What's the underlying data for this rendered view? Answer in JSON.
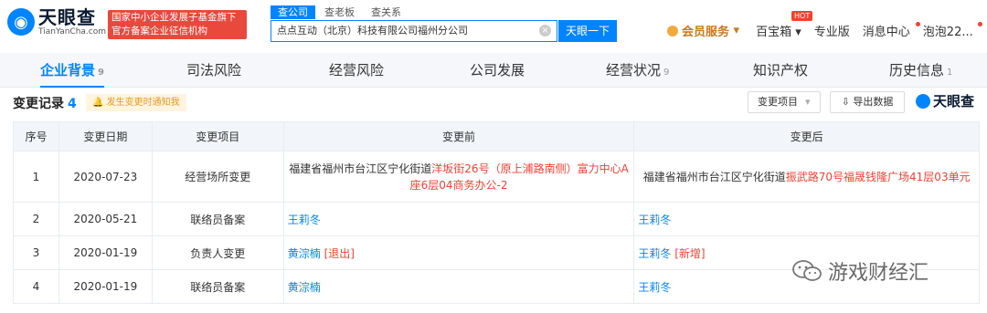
{
  "header": {
    "logo_cn": "天眼查",
    "logo_en": "TianYanCha.com",
    "gov_badge_line1": "国家中小企业发展子基金旗下",
    "gov_badge_line2": "官方备案企业征信机构",
    "search_tabs": [
      "查公司",
      "查老板",
      "查关系"
    ],
    "search_value": "点点互动（北京）科技有限公司福州分公司",
    "search_button": "天眼一下",
    "nav": {
      "vip": "会员服务",
      "treasure": "百宝箱",
      "hot": "HOT",
      "pro": "专业版",
      "messages": "消息中心",
      "user": "泡泡22..."
    }
  },
  "main_tabs": [
    {
      "label": "企业背景",
      "count": "9"
    },
    {
      "label": "司法风险",
      "count": ""
    },
    {
      "label": "经营风险",
      "count": ""
    },
    {
      "label": "公司发展",
      "count": ""
    },
    {
      "label": "经营状况",
      "count": "9"
    },
    {
      "label": "知识产权",
      "count": ""
    },
    {
      "label": "历史信息",
      "count": "1"
    }
  ],
  "section": {
    "title": "变更记录",
    "count": "4",
    "notify": "发生变更时通知我",
    "filter": "变更项目",
    "export": "导出数据",
    "brand": "天眼查"
  },
  "table": {
    "headers": [
      "序号",
      "变更日期",
      "变更项目",
      "变更前",
      "变更后"
    ],
    "rows": [
      {
        "idx": "1",
        "date": "2020-07-23",
        "item": "经营场所变更",
        "before_plain": "福建省福州市台江区宁化街道",
        "before_hl": "洋坂街26号（原上浦路南侧）富力中心A座6层04商务办公-2",
        "after_plain": "福建省福州市台江区宁化街道",
        "after_hl": "振武路70号福晟钱隆广场41层03单元"
      },
      {
        "idx": "2",
        "date": "2020-05-21",
        "item": "联络员备案",
        "before_name": "王莉冬",
        "before_tag": "",
        "after_name": "王莉冬",
        "after_tag": ""
      },
      {
        "idx": "3",
        "date": "2020-01-19",
        "item": "负责人变更",
        "before_name": "黄淙楠",
        "before_tag": "[退出]",
        "after_name": "王莉冬",
        "after_tag": "[新增]"
      },
      {
        "idx": "4",
        "date": "2020-01-19",
        "item": "联络员备案",
        "before_name": "黄淙楠",
        "before_tag": "",
        "after_name": "王莉冬",
        "after_tag": ""
      }
    ]
  },
  "watermark": "游戏财经汇"
}
